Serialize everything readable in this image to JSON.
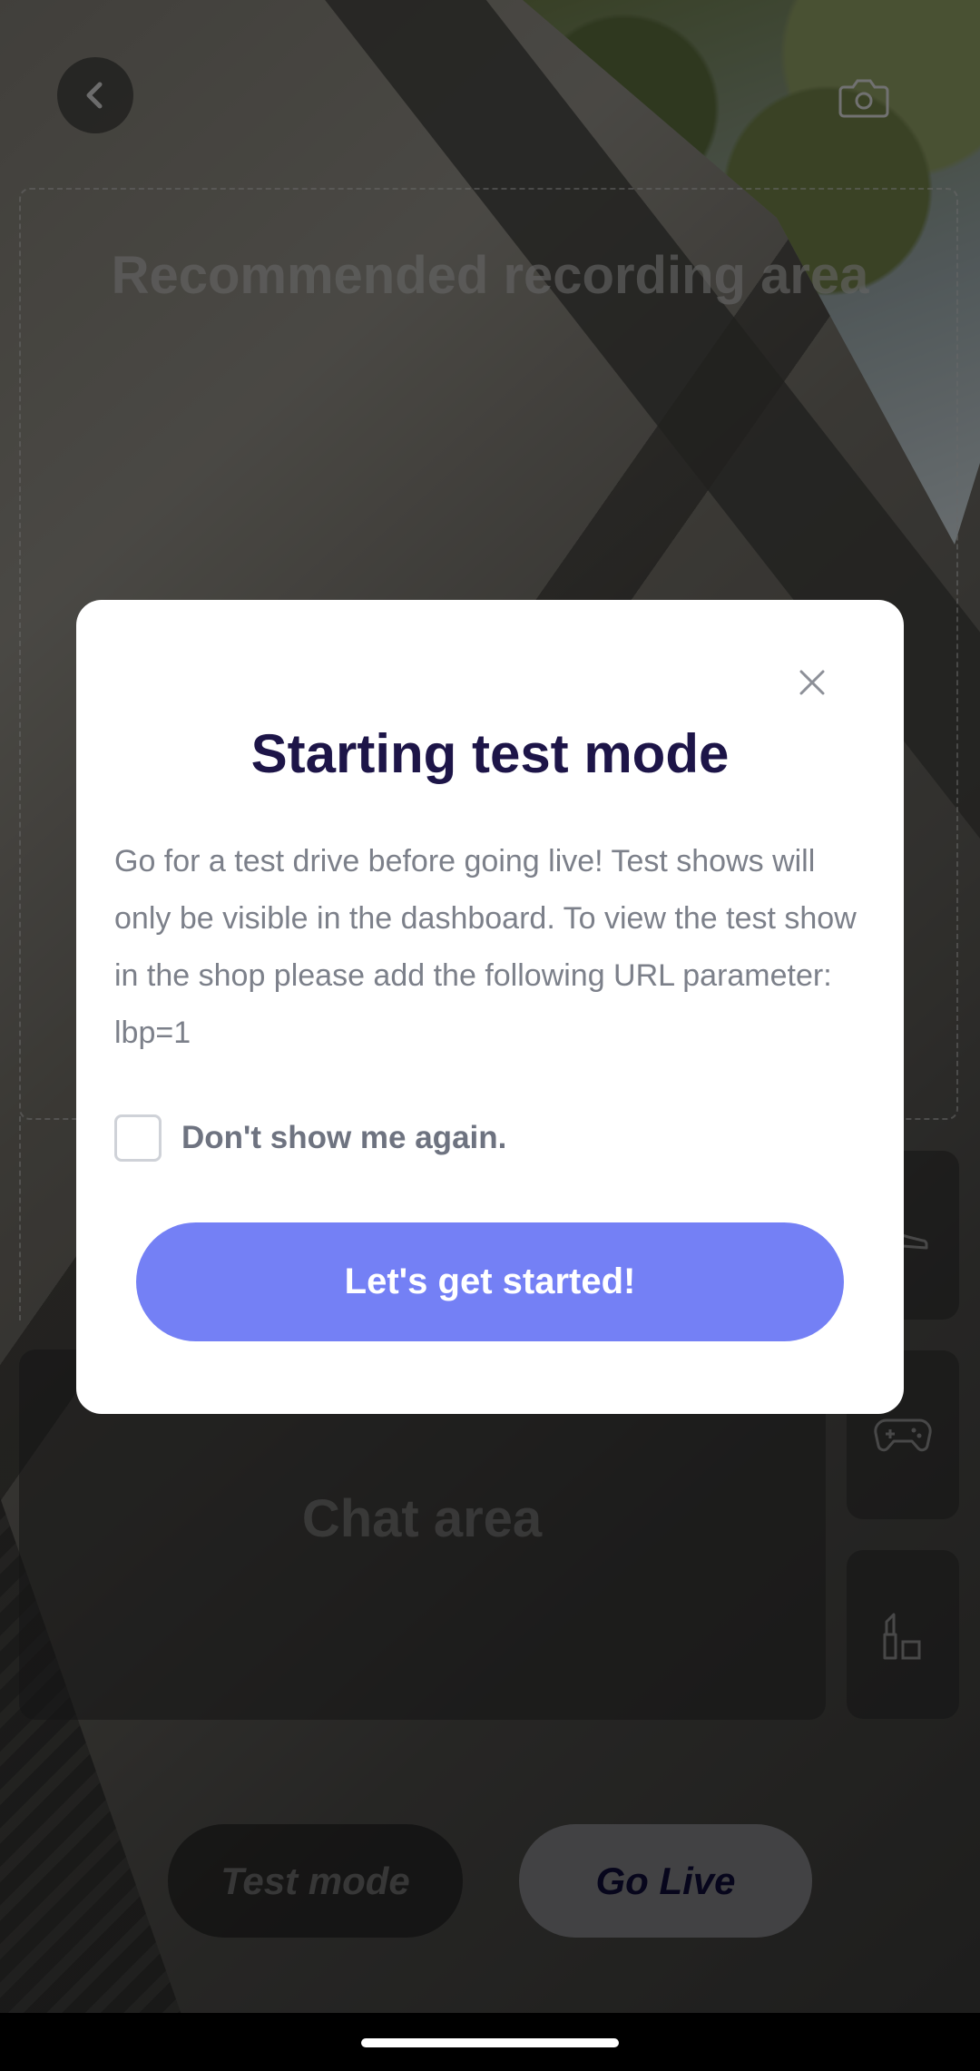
{
  "background": {
    "recording_area_label": "Recommended recording area",
    "chat_area_label": "Chat area",
    "side_buttons": [
      {
        "icon": "shoe-icon"
      },
      {
        "icon": "gamepad-icon"
      },
      {
        "icon": "lipstick-icon"
      }
    ],
    "test_mode_label": "Test mode",
    "go_live_label": "Go Live"
  },
  "modal": {
    "title": "Starting test mode",
    "body": "Go for a test drive before going live! Test shows will only be visible in the dashboard. To view the test show in the shop please add the following URL parameter: lbp=1",
    "checkbox_label": "Don't show me again.",
    "checkbox_checked": false,
    "cta_label": "Let's get started!"
  },
  "colors": {
    "accent": "#7480f5",
    "title": "#1d1548",
    "body_text": "#7c808a"
  }
}
